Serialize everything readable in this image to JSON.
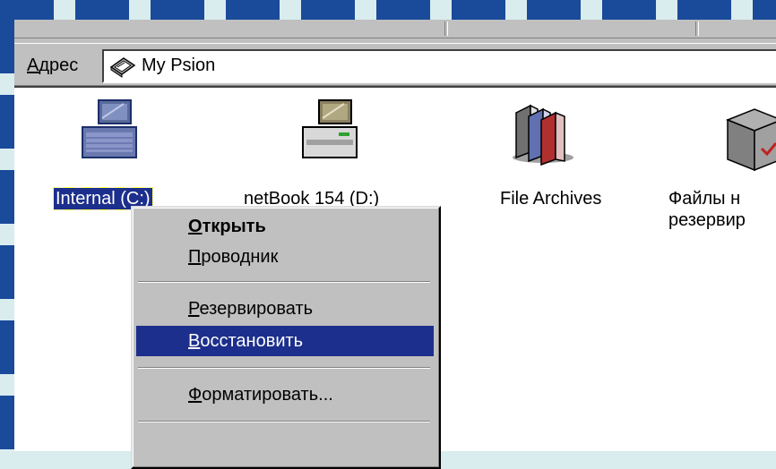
{
  "address_bar": {
    "label_underlined": "А",
    "label_rest": "дрес",
    "value": "My Psion",
    "icon": "psion-device-icon"
  },
  "items": [
    {
      "label": "Internal (C:)",
      "icon": "drive-c-icon",
      "selected": true
    },
    {
      "label": "netBook 154 (D:)",
      "icon": "drive-d-icon",
      "selected": false
    },
    {
      "label": "File Archives",
      "icon": "file-archives-icon",
      "selected": false
    },
    {
      "label_line1": "Файлы н",
      "label_line2": "резервир",
      "icon": "backup-files-icon",
      "selected": false
    }
  ],
  "context_menu": {
    "items": [
      {
        "underlined": "О",
        "rest": "ткрыть",
        "bold": true
      },
      {
        "underlined": "П",
        "rest": "роводник",
        "bold": false
      },
      {
        "underlined": "Р",
        "rest": "езервировать",
        "bold": false
      },
      {
        "underlined": "В",
        "rest": "осстановить",
        "bold": false,
        "active": true
      },
      {
        "underlined": "Ф",
        "rest": "орматировать...",
        "bold": false
      }
    ]
  },
  "colors": {
    "selection": "#1c2f8c",
    "frame": "#1a4a9a",
    "window_bg": "#c0c0c0"
  }
}
